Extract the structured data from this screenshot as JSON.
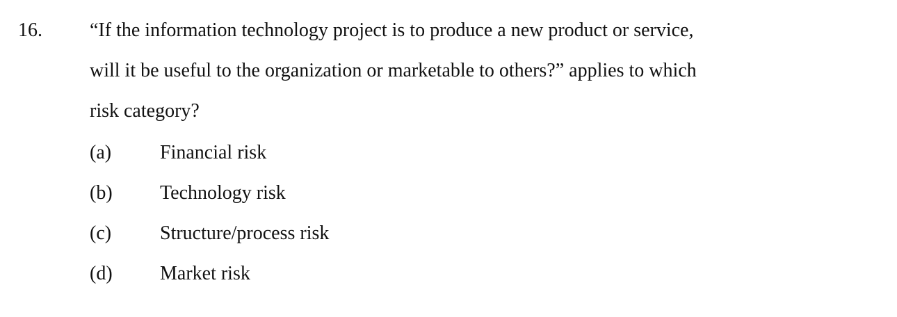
{
  "question": {
    "number": "16.",
    "lines": [
      "“If the information technology project is to produce a new product or service,",
      "will it be useful to the organization or marketable to others?” applies to which",
      "risk category?"
    ],
    "options": [
      {
        "letter": "(a)",
        "text": "Financial risk"
      },
      {
        "letter": "(b)",
        "text": "Technology risk"
      },
      {
        "letter": "(c)",
        "text": "Structure/process risk"
      },
      {
        "letter": "(d)",
        "text": "Market risk"
      }
    ]
  }
}
